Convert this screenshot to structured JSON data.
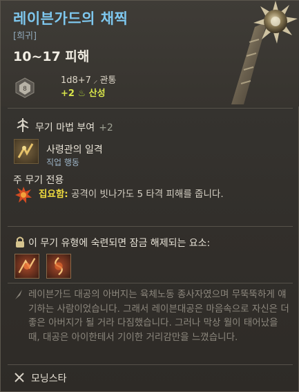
{
  "item": {
    "name": "레이븐가드의 채찍",
    "rarity": "[희귀]",
    "damage": "10~17 피해",
    "die_face": "8",
    "damage_dice": "1d8+7",
    "damage_type": "관통",
    "stat_bonus": "+2",
    "stat_name": "산성"
  },
  "enchant": {
    "label": "무기 마법 부여",
    "value": "+2"
  },
  "skill": {
    "name": "사령관의 일격",
    "category": "직업 행동"
  },
  "requirement": {
    "title": "주 무기 전용",
    "label": "집요함:",
    "text": "공격이 빗나가도 5 타격 피해를 줍니다."
  },
  "proficiency": {
    "text": "이 무기 유형에 숙련되면 잠금 해제되는 요소:"
  },
  "lore": "레이븐가드 대공의 아버지는 육체노동 종사자였으며 무뚝뚝하게 얘기하는 사람이었습니다. 그래서 레이븐대공은 마음속으로 자신은 더 좋은 아버지가 될 거라 다짐했습니다. 그러나 막상 월이 태어났을 때, 대공은 아이한테서 기이한 거리감만을 느꼈습니다.",
  "weapon_type": "모닝스타",
  "colors": {
    "title": "#7ec7ee",
    "stat": "#d9e64a",
    "keyword": "#f1dd3e"
  }
}
